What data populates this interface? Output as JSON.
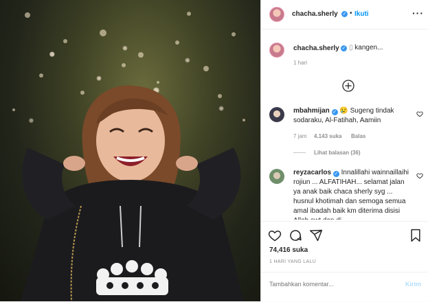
{
  "post": {
    "author": "chacha.sherly",
    "separator": "•",
    "follow_label": "Ikuti",
    "more_icon": "more-horizontal-icon"
  },
  "caption": {
    "author": "chacha.sherly",
    "text": "kangen...",
    "time": "1 hari"
  },
  "comments": [
    {
      "author": "mbahmijan",
      "text": "Sugeng tindak sodaraku, Al-Fatihah, Aamiin",
      "time": "7 jam",
      "likes": "4.143 suka",
      "reply": "Balas",
      "view_replies": "Lihat balasan (36)"
    },
    {
      "author": "reyzacarlos",
      "text": "Innalillahi wainnaillaihi rojiun ... ALFATIHAH... selamat jalan ya anak baik chaca sherly syg ... husnul khotimah dan semoga semua amal ibadah baik km diterima disisi Allah swt dan di"
    }
  ],
  "footer": {
    "likes": "74,416 suka",
    "posted": "1 HARI YANG LALU"
  },
  "composer": {
    "placeholder": "Tambahkan komentar...",
    "send": "Kirim"
  },
  "colors": {
    "accent": "#0095f6",
    "verified": "#3897f0",
    "send_disabled": "#b2dffc"
  }
}
